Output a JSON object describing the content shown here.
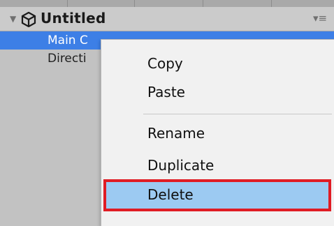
{
  "hierarchy": {
    "scene_title": "Untitled",
    "rows": [
      {
        "label": "Main C",
        "selected": true
      },
      {
        "label": "Directi",
        "selected": false
      }
    ]
  },
  "context_menu": {
    "items": [
      {
        "label": "Copy"
      },
      {
        "label": "Paste"
      },
      {
        "label": "Rename"
      },
      {
        "label": "Duplicate"
      },
      {
        "label": "Delete",
        "highlighted": true
      }
    ]
  },
  "colors": {
    "selection": "#3d7fe6",
    "highlight_fill": "#9ccaf2",
    "highlight_border": "#e01c24"
  },
  "icons": {
    "expand": "triangle-down",
    "scene": "unity-logo",
    "menu": "dropdown-menu"
  }
}
